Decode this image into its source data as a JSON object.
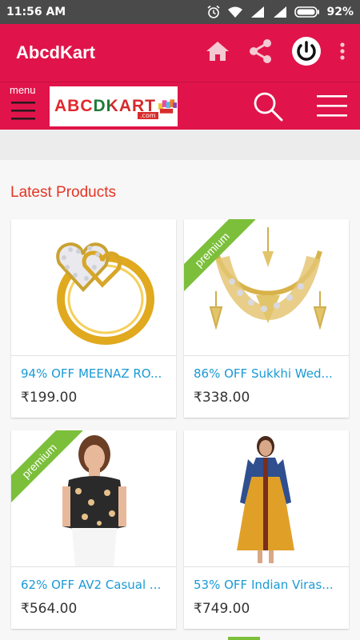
{
  "status": {
    "time": "11:56 AM",
    "battery": "92%"
  },
  "app": {
    "title": "AbcdKart"
  },
  "nav": {
    "menu_label": "menu",
    "logo_text": "ABCDKART",
    "logo_sub": ".com"
  },
  "section": {
    "title": "Latest Products"
  },
  "products": [
    {
      "name": "94% OFF MEENAZ RO...",
      "price": "₹199.00",
      "premium": false,
      "image": "gold-heart-ring"
    },
    {
      "name": "86% OFF Sukkhi Wed...",
      "price": "₹338.00",
      "premium": true,
      "badge": "premium",
      "image": "gold-necklace-set"
    },
    {
      "name": "62% OFF AV2 Casual ...",
      "price": "₹564.00",
      "premium": true,
      "badge": "premium",
      "image": "floral-top"
    },
    {
      "name": "53% OFF Indian Viras...",
      "price": "₹749.00",
      "premium": false,
      "image": "mustard-kurta"
    }
  ],
  "colors": {
    "primary": "#e0144a",
    "status_bar": "#4a4a4a",
    "title_red": "#e53524",
    "link_blue": "#1a9ad6",
    "ribbon_green": "#7cbf3a"
  },
  "icons": [
    "alarm-icon",
    "wifi-icon",
    "signal-icon",
    "battery-icon",
    "home-icon",
    "share-icon",
    "power-icon",
    "overflow-icon",
    "menu-icon",
    "search-icon",
    "list-icon"
  ]
}
